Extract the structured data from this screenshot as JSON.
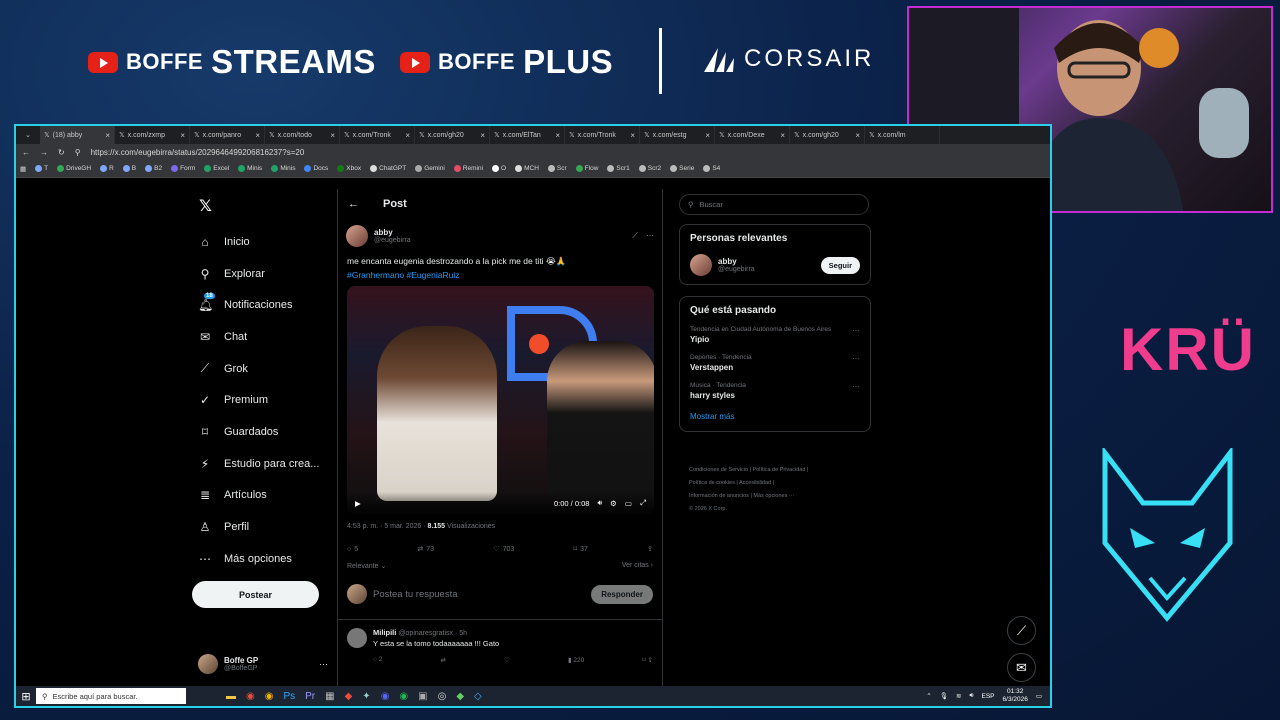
{
  "overlay": {
    "brand1_prefix": "BOFFE",
    "brand1_main": "STREAMS",
    "brand2_prefix": "BOFFE",
    "brand2_main": "PLUS",
    "sponsor": "CORSAIR",
    "team_logo": "KRÜ",
    "colors": {
      "youtube": "#e62117",
      "frame": "#2ad0e8",
      "webcam_border": "#c52bd4",
      "kru": "#ef3c8c"
    }
  },
  "browser": {
    "tabs": [
      "(18) abby",
      "x.com/zxmp",
      "x.com/panro",
      "x.com/todo",
      "x.com/Tronk",
      "x.com/gh20",
      "x.com/ElTan",
      "x.com/Tronk",
      "x.com/estg",
      "x.com/Dexe",
      "x.com/gh20",
      "x.com/lm"
    ],
    "url": "https://x.com/eugebirra/status/2029646499206816237?s=20",
    "bookmarks": [
      "T",
      "DriveGH",
      "R",
      "B",
      "B2",
      "Form",
      "Excel",
      "Minis",
      "Minis",
      "Docs",
      "Xbox",
      "ChatGPT",
      "Gemini",
      "Remini",
      "O",
      "MCH",
      "Scr",
      "Flow",
      "Scr1",
      "Scr2",
      "Serie",
      "S4"
    ]
  },
  "nav": {
    "items": [
      {
        "label": "Inicio",
        "icon": "home-icon"
      },
      {
        "label": "Explorar",
        "icon": "search-icon"
      },
      {
        "label": "Notificaciones",
        "icon": "bell-icon",
        "badge": "18"
      },
      {
        "label": "Chat",
        "icon": "mail-icon"
      },
      {
        "label": "Grok",
        "icon": "grok-icon"
      },
      {
        "label": "Premium",
        "icon": "premium-icon"
      },
      {
        "label": "Guardados",
        "icon": "bookmark-icon"
      },
      {
        "label": "Estudio para crea...",
        "icon": "studio-icon"
      },
      {
        "label": "Artículos",
        "icon": "articles-icon"
      },
      {
        "label": "Perfil",
        "icon": "user-icon"
      },
      {
        "label": "Más opciones",
        "icon": "more-icon"
      }
    ],
    "post_button": "Postear",
    "account_name": "Boffe GP",
    "account_handle": "@BoffeGP"
  },
  "main": {
    "title": "Post",
    "author_name": "abby",
    "author_handle": "@eugebirra",
    "text": "me encanta eugenia destrozando a la pick me de titi 😭🙏",
    "hashtags": "#Granhermano #EugeniaRuiz",
    "video_time": "0:00 / 0:08",
    "video_progress": 0,
    "timestamp": "4:53 p. m. · 5 mar. 2026 · ",
    "views_count": "8.155",
    "views_label": "Visualizaciones",
    "stats": {
      "replies": "5",
      "retweets": "73",
      "likes": "703",
      "bookmarks": "37"
    },
    "relevant": "Relevante",
    "view_quotes": "Ver citas",
    "reply_placeholder": "Postea tu respuesta",
    "reply_button": "Responder",
    "reply": {
      "name": "Milipili",
      "handle": "@opinaresgratisx · 5h",
      "text": "Y esta se la tomo todaaaaaaa !!! Gato",
      "replies": "2",
      "views": "220"
    }
  },
  "right": {
    "search_placeholder": "Buscar",
    "relevant_title": "Personas relevantes",
    "relevant_name": "abby",
    "relevant_handle": "@eugebirra",
    "follow": "Seguir",
    "trends_title": "Qué está pasando",
    "trends": [
      {
        "context": "Tendencia en Ciudad Autónoma de Buenos Aires",
        "topic": "Yipio"
      },
      {
        "context": "Deportes · Tendencia",
        "topic": "Verstappen"
      },
      {
        "context": "Música · Tendencia",
        "topic": "harry styles"
      }
    ],
    "show_more": "Mostrar más",
    "footer": {
      "line1": "Condiciones de Servicio  |  Política de Privacidad  |",
      "line2": "Política de cookies  |  Accesibilidad  |",
      "line3": "Información de anuncios  |  Más opciones ···",
      "line4": "© 2026 X Corp."
    }
  },
  "taskbar": {
    "search": "Escribe aquí para buscar.",
    "lang": "ESP",
    "time": "01:32",
    "date": "6/3/2026"
  }
}
